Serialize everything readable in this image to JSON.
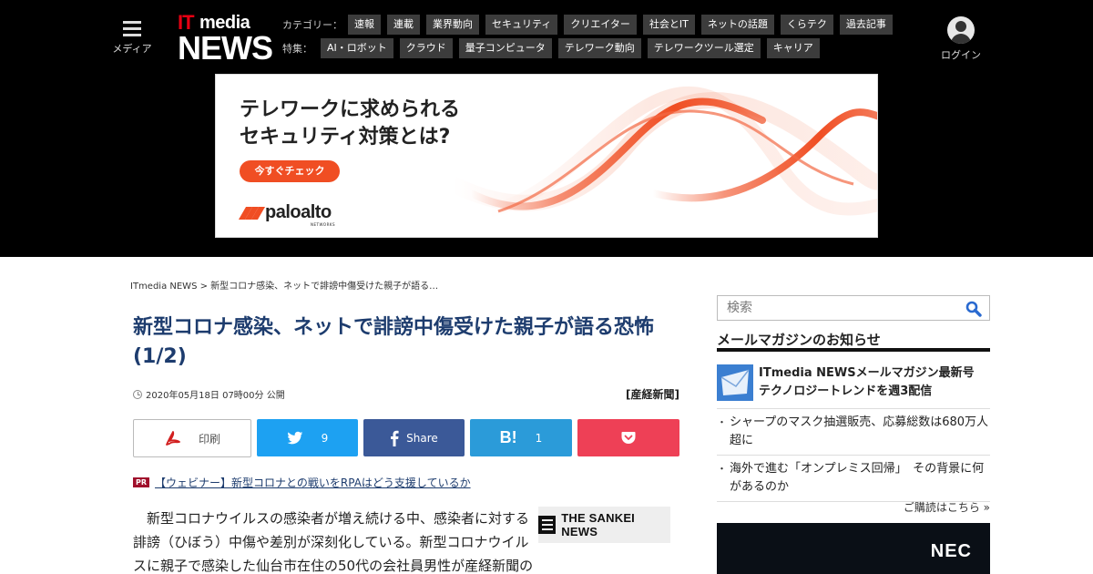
{
  "header": {
    "menu_label": "メディア",
    "logo_it": "IT",
    "logo_media": "media",
    "logo_news": "NEWS",
    "category_label": "カテゴリー：",
    "categories": [
      "速報",
      "連載",
      "業界動向",
      "セキュリティ",
      "クリエイター",
      "社会とIT",
      "ネットの話題",
      "くらテク",
      "過去記事"
    ],
    "feature_label": "特集：",
    "features": [
      "AI・ロボット",
      "クラウド",
      "量子コンピュータ",
      "テレワーク動向",
      "テレワークツール選定",
      "キャリア"
    ],
    "login_label": "ログイン"
  },
  "ad": {
    "headline_1": "テレワークに求められる",
    "headline_2": "セキュリティ対策とは?",
    "cta": "今すぐチェック",
    "brand": "paloalto",
    "brand_sub": "NETWORKS",
    "accent": "#f04e23"
  },
  "breadcrumb": "ITmedia NEWS > 新型コロナ感染、ネットで誹謗中傷受けた親子が語る…",
  "article": {
    "title": "新型コロナ感染、ネットで誹謗中傷受けた親子が語る恐怖 (1/2)",
    "date": "2020年05月18日 07時00分 公開",
    "source": "[産経新聞]",
    "title_color": "#1d3c6e",
    "body": "　新型コロナウイルスの感染者が増え続ける中、感染者に対する誹謗（ひぼう）中傷や差別が深刻化している。新型コロナウイルスに親子で感染した仙台市在住の50代の会社員男性が産経新聞の取材に応",
    "partner_logo": "THE SANKEI NEWS"
  },
  "share": {
    "print": "印刷",
    "twitter_count": "9",
    "facebook": "Share",
    "hatena_label": "B!",
    "hatena_count": "1"
  },
  "pr": {
    "badge": "PR",
    "link": "【ウェビナー】新型コロナとの戦いをRPAはどう支援しているか"
  },
  "sidebar": {
    "search_placeholder": "検索",
    "newsletter_heading": "メールマガジンのお知らせ",
    "featured": "ITmedia NEWSメールマガジン最新号　テクノロジートレンドを週3配信",
    "items": [
      "シャープのマスク抽選販売、応募総数は680万人超に",
      "海外で進む「オンプレミス回帰」　その背景に何があるのか"
    ],
    "more": "ご購読はこちら »",
    "ad_brand": "NEC"
  }
}
